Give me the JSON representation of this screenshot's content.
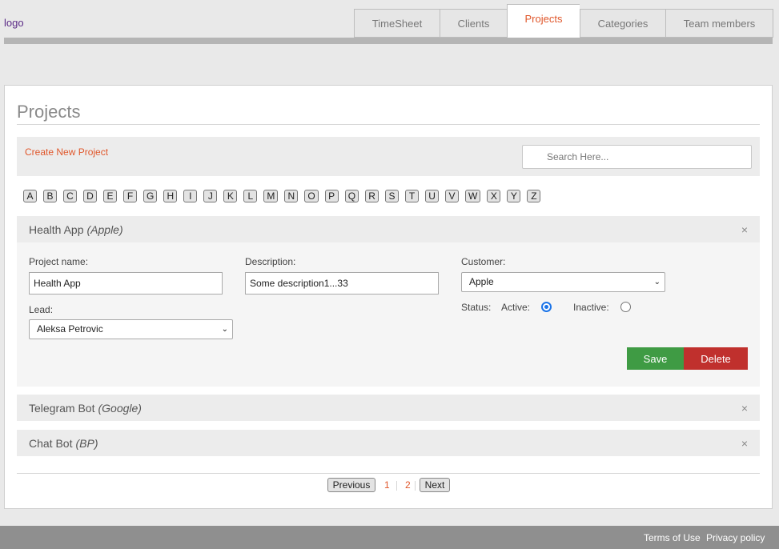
{
  "header": {
    "logo": "logo",
    "tabs": [
      "TimeSheet",
      "Clients",
      "Projects",
      "Categories",
      "Team members"
    ],
    "active_tab": "Projects"
  },
  "main": {
    "title": "Projects",
    "create_link": "Create New Project",
    "search_placeholder": "Search Here...",
    "letters": [
      "A",
      "B",
      "C",
      "D",
      "E",
      "F",
      "G",
      "H",
      "I",
      "J",
      "K",
      "L",
      "M",
      "N",
      "O",
      "P",
      "Q",
      "R",
      "S",
      "T",
      "U",
      "V",
      "W",
      "X",
      "Y",
      "Z"
    ],
    "projects": [
      {
        "name": "Health App",
        "client": "(Apple)",
        "expanded": true,
        "form": {
          "project_name_label": "Project name:",
          "project_name_value": "Health App",
          "description_label": "Description:",
          "description_value": "Some description1...33",
          "customer_label": "Customer:",
          "customer_value": "Apple",
          "lead_label": "Lead:",
          "lead_value": "Aleksa Petrovic",
          "status_label": "Status:",
          "active_label": "Active:",
          "inactive_label": "Inactive:",
          "status_value": "active",
          "save_label": "Save",
          "delete_label": "Delete"
        }
      },
      {
        "name": "Telegram Bot",
        "client": "(Google)",
        "expanded": false
      },
      {
        "name": "Chat Bot",
        "client": "(BP)",
        "expanded": false
      }
    ],
    "close_icon": "×"
  },
  "pagination": {
    "previous_label": "Previous",
    "pages": [
      "1",
      "2"
    ],
    "next_label": "Next"
  },
  "footer": {
    "terms_label": "Terms of Use",
    "privacy_label": "Privacy policy"
  },
  "colors": {
    "accent": "#e0572b",
    "save": "#3f9b44",
    "delete": "#c0302d",
    "radio": "#1a73e8"
  }
}
